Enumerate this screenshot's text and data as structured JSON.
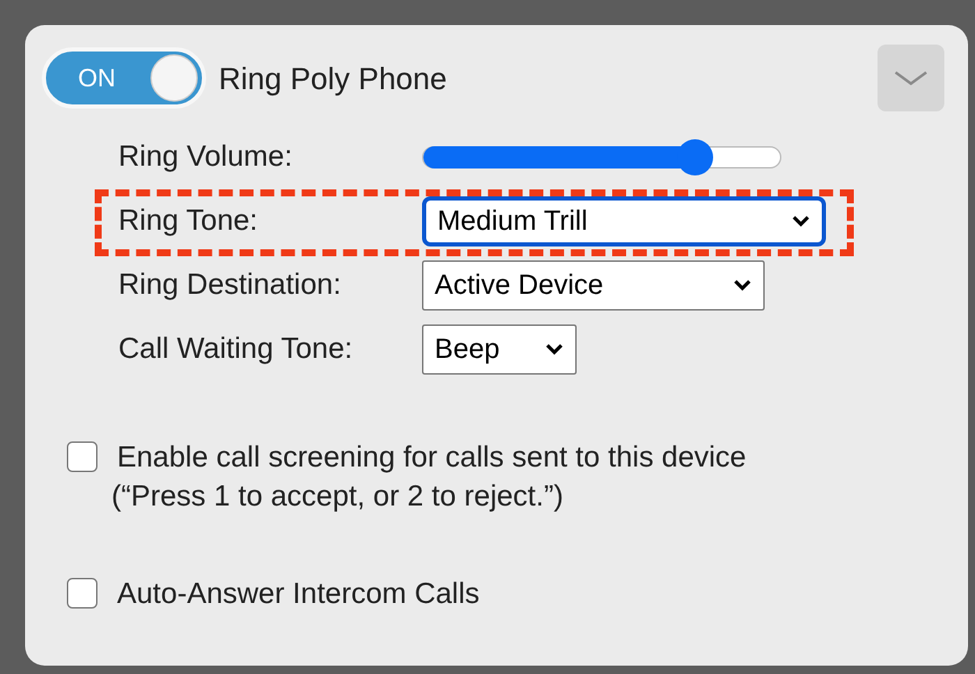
{
  "header": {
    "toggle": {
      "label": "ON",
      "on": true
    },
    "title": "Ring Poly Phone"
  },
  "settings": [
    {
      "kind": "slider",
      "label": "Ring Volume:",
      "level": 0.76,
      "highlighted": false
    },
    {
      "kind": "select",
      "label": "Ring Tone:",
      "value": "Medium Trill",
      "focused": true,
      "highlighted": true
    },
    {
      "kind": "select",
      "label": "Ring Destination:",
      "value": "Active Device",
      "focused": false,
      "highlighted": false
    },
    {
      "kind": "select",
      "label": "Call Waiting Tone:",
      "value": "Beep",
      "focused": false,
      "highlighted": false
    }
  ],
  "options": [
    {
      "label": "Enable call screening for calls sent to this device",
      "note": "(“Press 1 to accept, or 2 to reject.”)",
      "checked": false
    },
    {
      "label": "Auto-Answer Intercom Calls",
      "checked": false
    }
  ]
}
